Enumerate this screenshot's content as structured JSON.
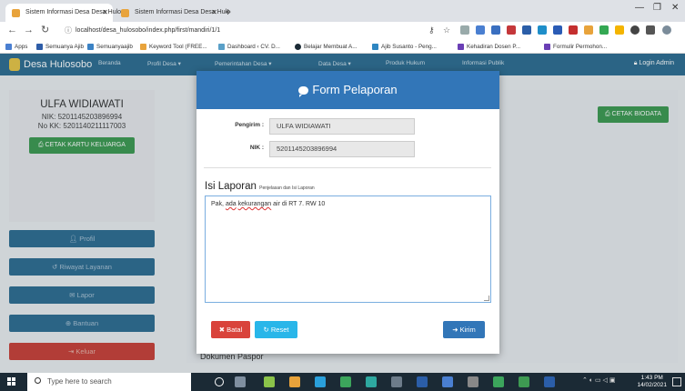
{
  "browser": {
    "tabs": [
      {
        "title": "Sistem Informasi Desa Desa Hulo",
        "active": true
      },
      {
        "title": "Sistem Informasi Desa Desa Hulo",
        "active": false
      }
    ],
    "new_tab": "+",
    "url": "localhost/desa_hulosobo/index.php/first/mandiri/1/1",
    "bookmarks": [
      "Apps",
      "Semuanya Ajib",
      "Semuanyaajib",
      "Keyword Tool (FREE...",
      "Dashboard ‹ CV. D...",
      "Belajar Membuat A...",
      "Ajib Susanto - Peng...",
      "Kehadiran Dosen P...",
      "Formulir Permohon..."
    ]
  },
  "site": {
    "brand": "Desa Hulosobo",
    "nav": [
      "Beranda",
      "Profil Desa ▾",
      "Pemerintahan Desa ▾",
      "Data Desa ▾",
      "Produk Hukum",
      "Informasi Publik"
    ],
    "login": "Login Admin"
  },
  "profile": {
    "name": "ULFA WIDIAWATI",
    "nik": "NIK: 5201145203896994",
    "nokk": "No KK: 5201140211117003",
    "kk_button": "CETAK KARTU KELUARGA"
  },
  "sidebar": [
    "Profil",
    "Riwayat Layanan",
    "Lapor",
    "Bantuan",
    "Keluar"
  ],
  "main": {
    "cetak_biodata": "CETAK BIODATA",
    "dokumen_paspor": "Dokumen Paspor"
  },
  "modal": {
    "title": "Form Pelaporan",
    "pengirim_label": "Pengirim :",
    "pengirim_value": "ULFA WIDIAWATI",
    "nik_label": "NIK :",
    "nik_value": "5201145203896994",
    "isi_label": "Isi Laporan",
    "isi_sub": "Penjelasan dan Isi Laporan",
    "text_pre": "Pak, ",
    "text_sq1": "ada",
    "text_mid": " ",
    "text_sq2": "kekurangan",
    "text_post": " air di RT 7. RW 10",
    "btn_batal": "Batal",
    "btn_reset": "Reset",
    "btn_kirim": "Kirim"
  },
  "taskbar": {
    "search_placeholder": "Type here to search",
    "time": "1:43 PM",
    "date": "14/02/2021"
  }
}
